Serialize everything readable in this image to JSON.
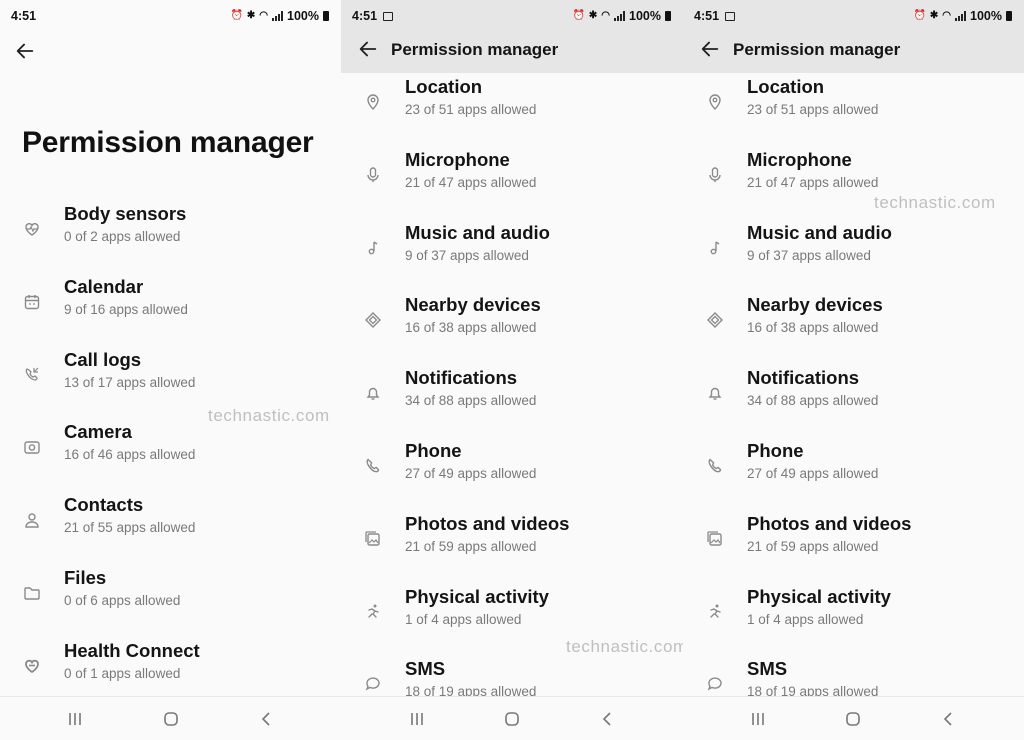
{
  "watermark": "technastic.com",
  "screens": [
    {
      "status": {
        "time": "4:51",
        "battery": "100%"
      },
      "title": "Permission manager",
      "items": [
        {
          "name": "Body sensors",
          "sub": "0 of 2 apps allowed",
          "icon": "heart-icon"
        },
        {
          "name": "Calendar",
          "sub": "9 of 16 apps allowed",
          "icon": "calendar-icon"
        },
        {
          "name": "Call logs",
          "sub": "13 of 17 apps allowed",
          "icon": "call-log-icon"
        },
        {
          "name": "Camera",
          "sub": "16 of 46 apps allowed",
          "icon": "camera-icon"
        },
        {
          "name": "Contacts",
          "sub": "21 of 55 apps allowed",
          "icon": "person-icon"
        },
        {
          "name": "Files",
          "sub": "0 of 6 apps allowed",
          "icon": "folder-icon"
        },
        {
          "name": "Health Connect",
          "sub": "0 of 1 apps allowed",
          "icon": "health-icon"
        }
      ]
    },
    {
      "status": {
        "time": "4:51",
        "battery": "100%"
      },
      "title": "Permission manager",
      "items": [
        {
          "name": "Location",
          "sub": "23 of 51 apps allowed",
          "icon": "location-icon"
        },
        {
          "name": "Microphone",
          "sub": "21 of 47 apps allowed",
          "icon": "microphone-icon"
        },
        {
          "name": "Music and audio",
          "sub": "9 of 37 apps allowed",
          "icon": "music-icon"
        },
        {
          "name": "Nearby devices",
          "sub": "16 of 38 apps allowed",
          "icon": "nearby-icon"
        },
        {
          "name": "Notifications",
          "sub": "34 of 88 apps allowed",
          "icon": "bell-icon"
        },
        {
          "name": "Phone",
          "sub": "27 of 49 apps allowed",
          "icon": "phone-icon"
        },
        {
          "name": "Photos and videos",
          "sub": "21 of 59 apps allowed",
          "icon": "photos-icon"
        },
        {
          "name": "Physical activity",
          "sub": "1 of 4 apps allowed",
          "icon": "activity-icon"
        },
        {
          "name": "SMS",
          "sub": "18 of 19 apps allowed",
          "icon": "sms-icon"
        }
      ]
    },
    {
      "status": {
        "time": "4:51",
        "battery": "100%"
      },
      "title": "Permission manager",
      "items": [
        {
          "name": "Location",
          "sub": "23 of 51 apps allowed",
          "icon": "location-icon"
        },
        {
          "name": "Microphone",
          "sub": "21 of 47 apps allowed",
          "icon": "microphone-icon"
        },
        {
          "name": "Music and audio",
          "sub": "9 of 37 apps allowed",
          "icon": "music-icon"
        },
        {
          "name": "Nearby devices",
          "sub": "16 of 38 apps allowed",
          "icon": "nearby-icon"
        },
        {
          "name": "Notifications",
          "sub": "34 of 88 apps allowed",
          "icon": "bell-icon"
        },
        {
          "name": "Phone",
          "sub": "27 of 49 apps allowed",
          "icon": "phone-icon"
        },
        {
          "name": "Photos and videos",
          "sub": "21 of 59 apps allowed",
          "icon": "photos-icon"
        },
        {
          "name": "Physical activity",
          "sub": "1 of 4 apps allowed",
          "icon": "activity-icon"
        },
        {
          "name": "SMS",
          "sub": "18 of 19 apps allowed",
          "icon": "sms-icon"
        }
      ]
    }
  ]
}
